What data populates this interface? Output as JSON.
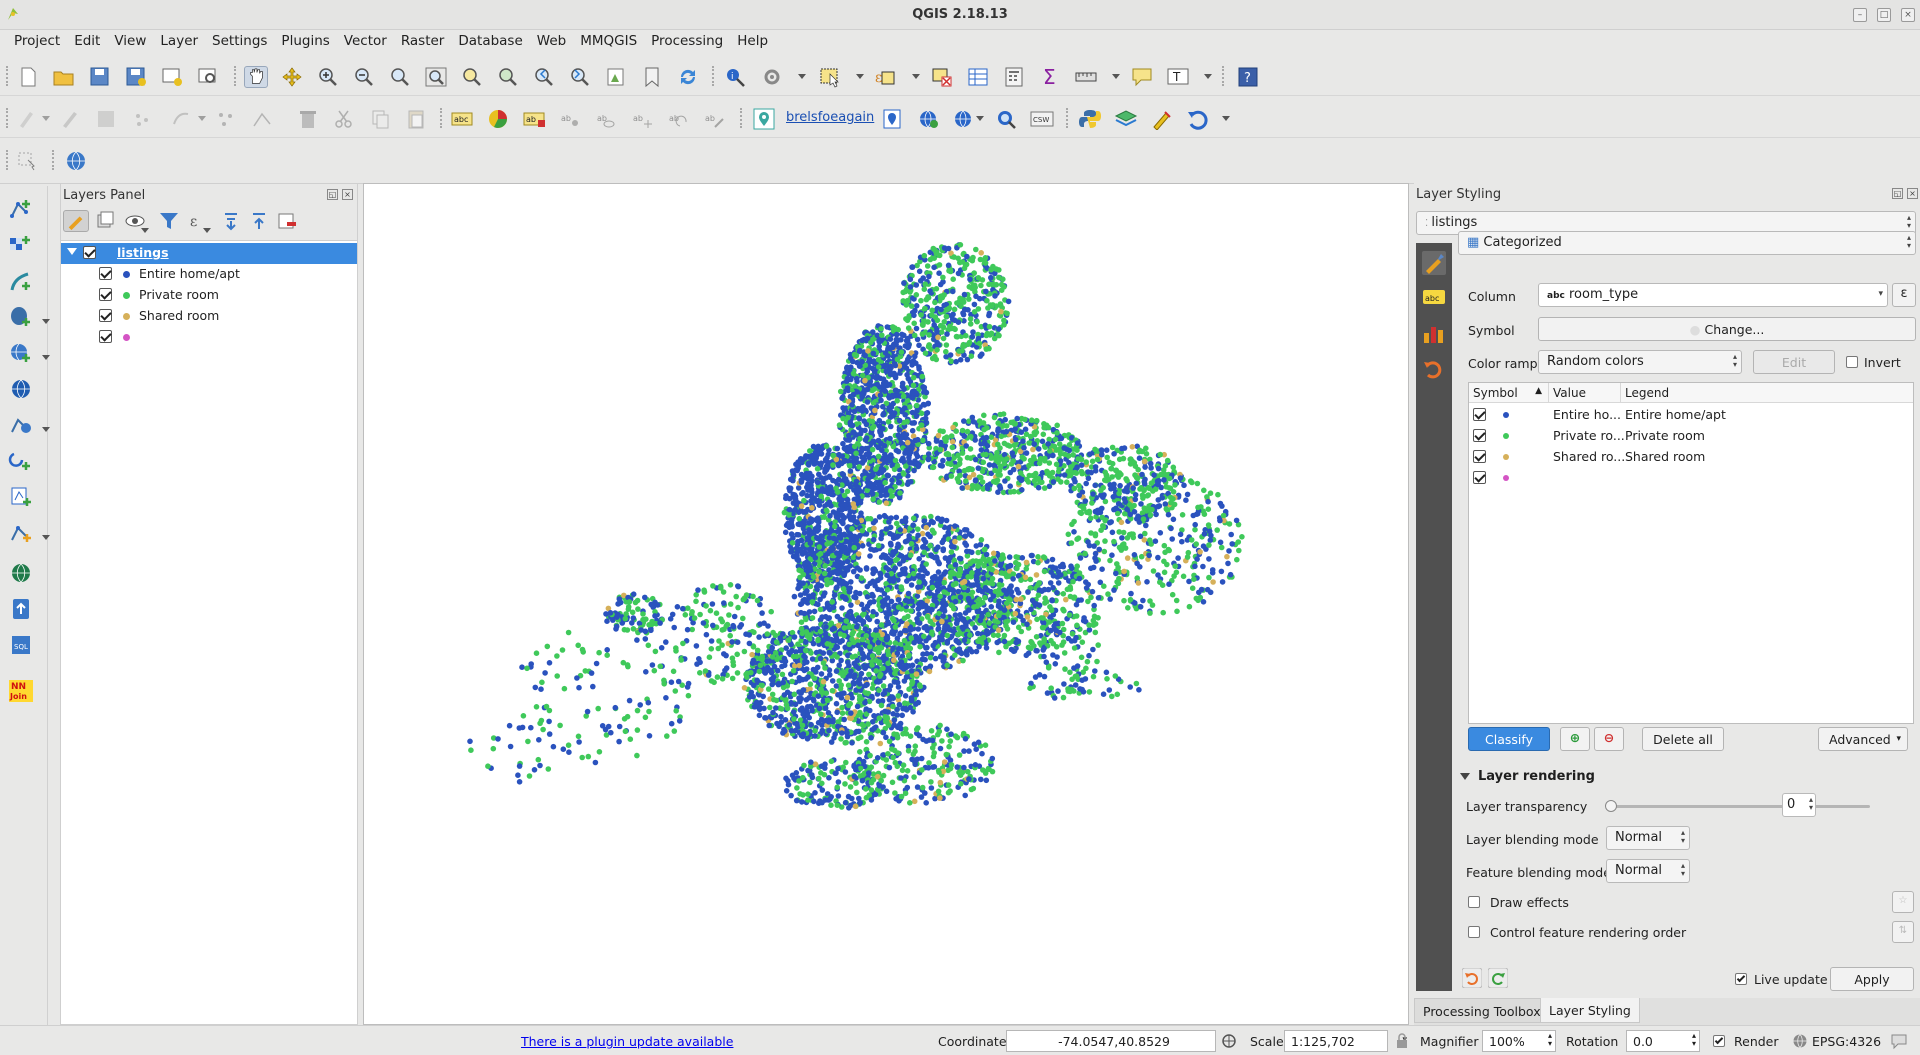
{
  "window": {
    "title": "QGIS 2.18.13"
  },
  "menu": [
    "Project",
    "Edit",
    "View",
    "Layer",
    "Settings",
    "Plugins",
    "Vector",
    "Raster",
    "Database",
    "Web",
    "MMQGIS",
    "Processing",
    "Help"
  ],
  "toolbar2": {
    "plugin_label": "brelsfoeagain",
    "csw_label": "CSW"
  },
  "layers_panel": {
    "title": "Layers Panel",
    "layer": {
      "name": "listings",
      "checked": true
    },
    "categories": [
      {
        "label": "Entire home/apt",
        "color": "#2a52be",
        "checked": true
      },
      {
        "label": "Private room",
        "color": "#3fc95a",
        "checked": true
      },
      {
        "label": "Shared room",
        "color": "#d6b05a",
        "checked": true
      },
      {
        "label": "",
        "color": "#d454c4",
        "checked": true
      }
    ]
  },
  "styling": {
    "title": "Layer Styling",
    "layer_select": "listings",
    "renderer": "Categorized",
    "column_label": "Column",
    "column_value": "room_type",
    "column_badge": "abc",
    "symbol_label": "Symbol",
    "symbol_button": "Change...",
    "ramp_label": "Color ramp",
    "ramp_value": "Random colors",
    "edit_button": "Edit",
    "invert_label": "Invert",
    "table_headers": [
      "Symbol",
      "Value",
      "Legend"
    ],
    "rows": [
      {
        "value": "Entire ho...",
        "legend": "Entire home/apt",
        "color": "#2a52be"
      },
      {
        "value": "Private ro...",
        "legend": "Private room",
        "color": "#3fc95a"
      },
      {
        "value": "Shared ro...",
        "legend": "Shared room",
        "color": "#d6b05a"
      },
      {
        "value": "",
        "legend": "",
        "color": "#d454c4"
      }
    ],
    "classify_button": "Classify",
    "delete_all_button": "Delete all",
    "advanced_button": "Advanced",
    "rendering_section": "Layer rendering",
    "transparency_label": "Layer transparency",
    "transparency_value": "0",
    "layer_blend_label": "Layer blending mode",
    "layer_blend_value": "Normal",
    "feature_blend_label": "Feature blending mode",
    "feature_blend_value": "Normal",
    "draw_effects_label": "Draw effects",
    "control_order_label": "Control feature rendering order",
    "live_update_label": "Live update",
    "apply_button": "Apply"
  },
  "dock_tabs": [
    "Processing Toolbox",
    "Layer Styling"
  ],
  "status": {
    "plugin_update": "There is a plugin update available",
    "coordinate_label": "Coordinate",
    "coordinate_value": "-74.0547,40.8529",
    "scale_label": "Scale",
    "scale_value": "1:125,702",
    "magnifier_label": "Magnifier",
    "magnifier_value": "100%",
    "rotation_label": "Rotation",
    "rotation_value": "0.0",
    "render_label": "Render",
    "crs": "EPSG:4326"
  }
}
